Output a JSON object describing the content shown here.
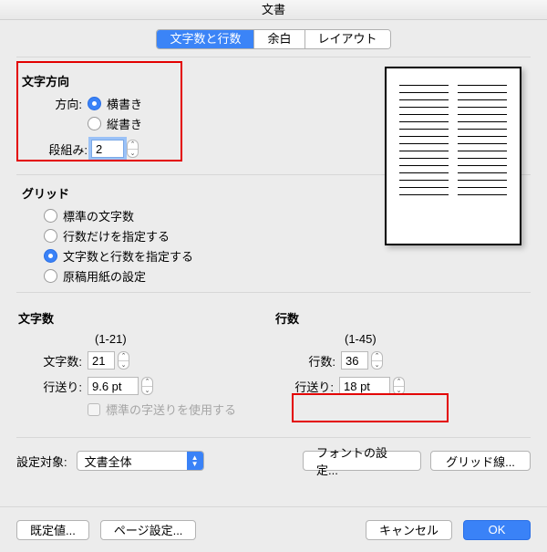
{
  "window": {
    "title": "文書"
  },
  "tabs": {
    "items": [
      {
        "label": "文字数と行数",
        "active": true
      },
      {
        "label": "余白",
        "active": false
      },
      {
        "label": "レイアウト",
        "active": false
      }
    ]
  },
  "direction": {
    "group_title": "文字方向",
    "orientation_label": "方向:",
    "horizontal": "横書き",
    "vertical": "縦書き",
    "orientation_value": "horizontal",
    "columns_label": "段組み:",
    "columns_value": "2"
  },
  "grid": {
    "group_title": "グリッド",
    "options": {
      "standard": "標準の文字数",
      "lines_only": "行数だけを指定する",
      "chars_and_lines": "文字数と行数を指定する",
      "genkou": "原稿用紙の設定"
    },
    "value": "chars_and_lines"
  },
  "chars": {
    "group_title": "文字数",
    "range": "(1-21)",
    "count_label": "文字数:",
    "count_value": "21",
    "pitch_label": "行送り:",
    "pitch_value": "9.6 pt",
    "use_default_pitch": "標準の字送りを使用する"
  },
  "lines": {
    "group_title": "行数",
    "range": "(1-45)",
    "count_label": "行数:",
    "count_value": "36",
    "pitch_label": "行送り:",
    "pitch_value": "18 pt"
  },
  "apply": {
    "label": "設定対象:",
    "value": "文書全体",
    "font_button": "フォントの設定...",
    "gridlines_button": "グリッド線..."
  },
  "footer": {
    "defaults": "既定値...",
    "page_setup": "ページ設定...",
    "cancel": "キャンセル",
    "ok": "OK"
  }
}
